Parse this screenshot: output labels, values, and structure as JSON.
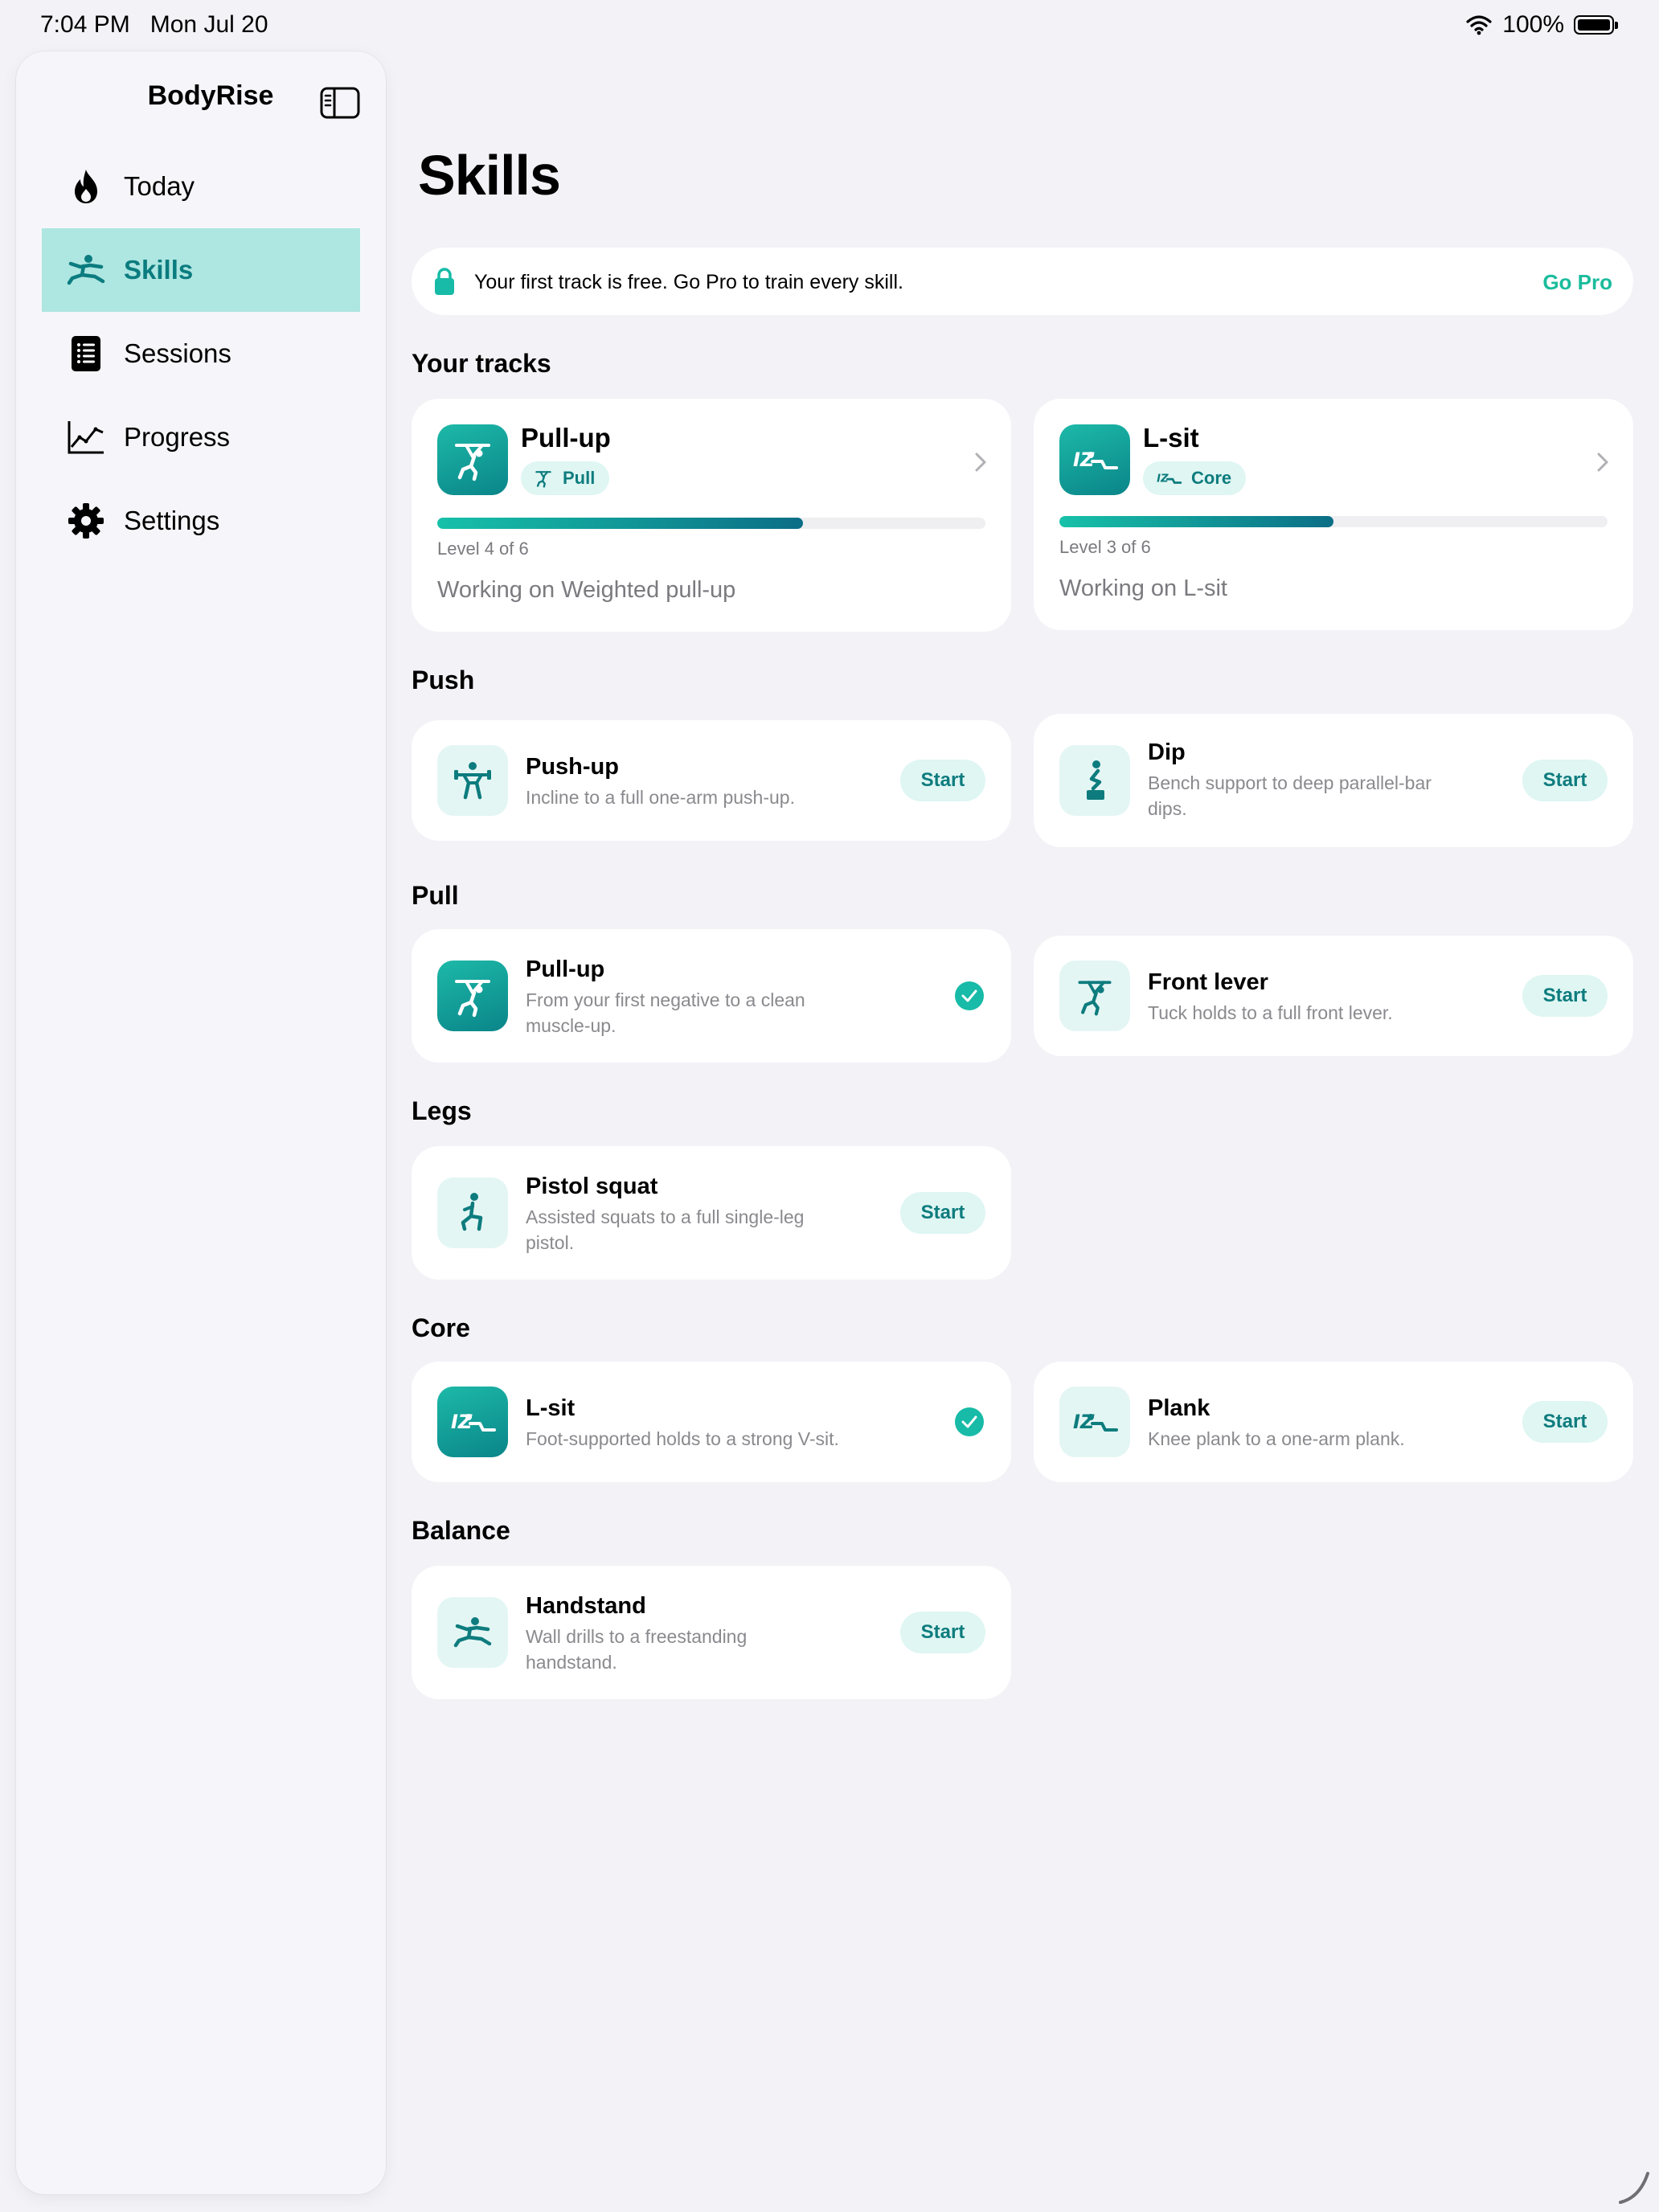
{
  "status": {
    "time": "7:04 PM",
    "date": "Mon Jul 20",
    "battery": "100%"
  },
  "sidebar": {
    "title": "BodyRise",
    "items": [
      {
        "label": "Today",
        "icon": "flame-icon"
      },
      {
        "label": "Skills",
        "icon": "figure-icon",
        "active": true
      },
      {
        "label": "Sessions",
        "icon": "list-icon"
      },
      {
        "label": "Progress",
        "icon": "chart-icon"
      },
      {
        "label": "Settings",
        "icon": "gear-icon"
      }
    ]
  },
  "page": {
    "title": "Skills"
  },
  "banner": {
    "text": "Your first track is free. Go Pro to train every skill.",
    "action": "Go Pro"
  },
  "sections": {
    "tracks": "Your tracks",
    "push": "Push",
    "pull": "Pull",
    "legs": "Legs",
    "core": "Core",
    "balance": "Balance"
  },
  "tracks": [
    {
      "name": "Pull-up",
      "tag": "Pull",
      "level": "Level 4 of 6",
      "progress": 0.667,
      "working": "Working on Weighted pull-up"
    },
    {
      "name": "L-sit",
      "tag": "Core",
      "level": "Level 3 of 6",
      "progress": 0.5,
      "working": "Working on L-sit"
    }
  ],
  "skills": {
    "pushup": {
      "name": "Push-up",
      "desc": "Incline to a full one-arm push-up.",
      "action": "Start"
    },
    "dip": {
      "name": "Dip",
      "desc": "Bench support to deep parallel-bar dips.",
      "action": "Start"
    },
    "pullup": {
      "name": "Pull-up",
      "desc": "From your first negative to a clean muscle-up.",
      "active": true
    },
    "frontlever": {
      "name": "Front lever",
      "desc": "Tuck holds to a full front lever.",
      "action": "Start"
    },
    "pistol": {
      "name": "Pistol squat",
      "desc": "Assisted squats to a full single-leg pistol.",
      "action": "Start"
    },
    "lsit": {
      "name": "L-sit",
      "desc": "Foot-supported holds to a strong V-sit.",
      "active": true
    },
    "plank": {
      "name": "Plank",
      "desc": "Knee plank to a one-arm plank.",
      "action": "Start"
    },
    "handstand": {
      "name": "Handstand",
      "desc": "Wall drills to a freestanding handstand.",
      "action": "Start"
    }
  },
  "colors": {
    "accent": "#1ABC9C",
    "accentDark": "#0E7C7E",
    "sidebarActive": "#AEE6E1",
    "background": "#F2F2F7"
  }
}
